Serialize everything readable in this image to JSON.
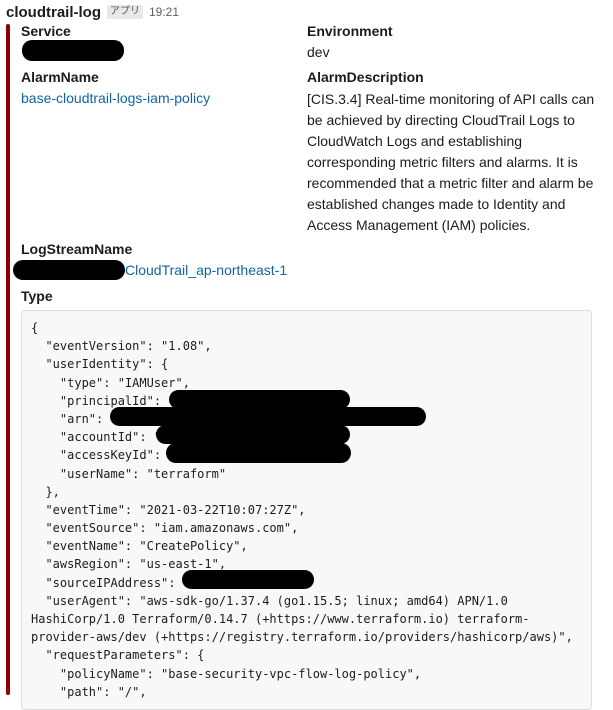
{
  "header": {
    "app_name": "cloudtrail-log",
    "app_badge": "アプリ",
    "time": "19:21"
  },
  "colors": {
    "attachment_bar": "#8b0000",
    "link": "#1264a3",
    "redaction": "#000000"
  },
  "fields": {
    "service": {
      "label": "Service",
      "value": ""
    },
    "environment": {
      "label": "Environment",
      "value": "dev"
    },
    "alarm_name": {
      "label": "AlarmName",
      "value": "base-cloudtrail-logs-iam-policy"
    },
    "alarm_description": {
      "label": "AlarmDescription",
      "value": "[CIS.3.4] Real-time monitoring of API calls can be achieved by directing CloudTrail Logs to CloudWatch Logs and establishing corresponding metric filters and alarms. It is recommended that a metric filter and alarm be established changes made to Identity and Access Management (IAM) policies."
    },
    "log_stream_name": {
      "label": "LogStreamName",
      "value": "CloudTrail_ap-northeast-1"
    },
    "type": {
      "label": "Type"
    }
  },
  "code_lines": [
    "{",
    "  \"eventVersion\": \"1.08\",",
    "  \"userIdentity\": {",
    "    \"type\": \"IAMUser\",",
    "    \"principalId\": \"",
    "    \"arn\": \"",
    "    \"accountId\": \"",
    "    \"accessKeyId\": \"",
    "    \"userName\": \"terraform\"",
    "  },",
    "  \"eventTime\": \"2021-03-22T10:07:27Z\",",
    "  \"eventSource\": \"iam.amazonaws.com\",",
    "  \"eventName\": \"CreatePolicy\",",
    "  \"awsRegion\": \"us-east-1\",",
    "  \"sourceIPAddress\": \"",
    "  \"userAgent\": \"aws-sdk-go/1.37.4 (go1.15.5; linux; amd64) APN/1.0",
    "HashiCorp/1.0 Terraform/0.14.7 (+https://www.terraform.io) terraform-",
    "provider-aws/dev (+https://registry.terraform.io/providers/hashicorp/aws)\",",
    "  \"requestParameters\": {",
    "    \"policyName\": \"base-security-vpc-flow-log-policy\",",
    "    \"path\": \"/\","
  ]
}
